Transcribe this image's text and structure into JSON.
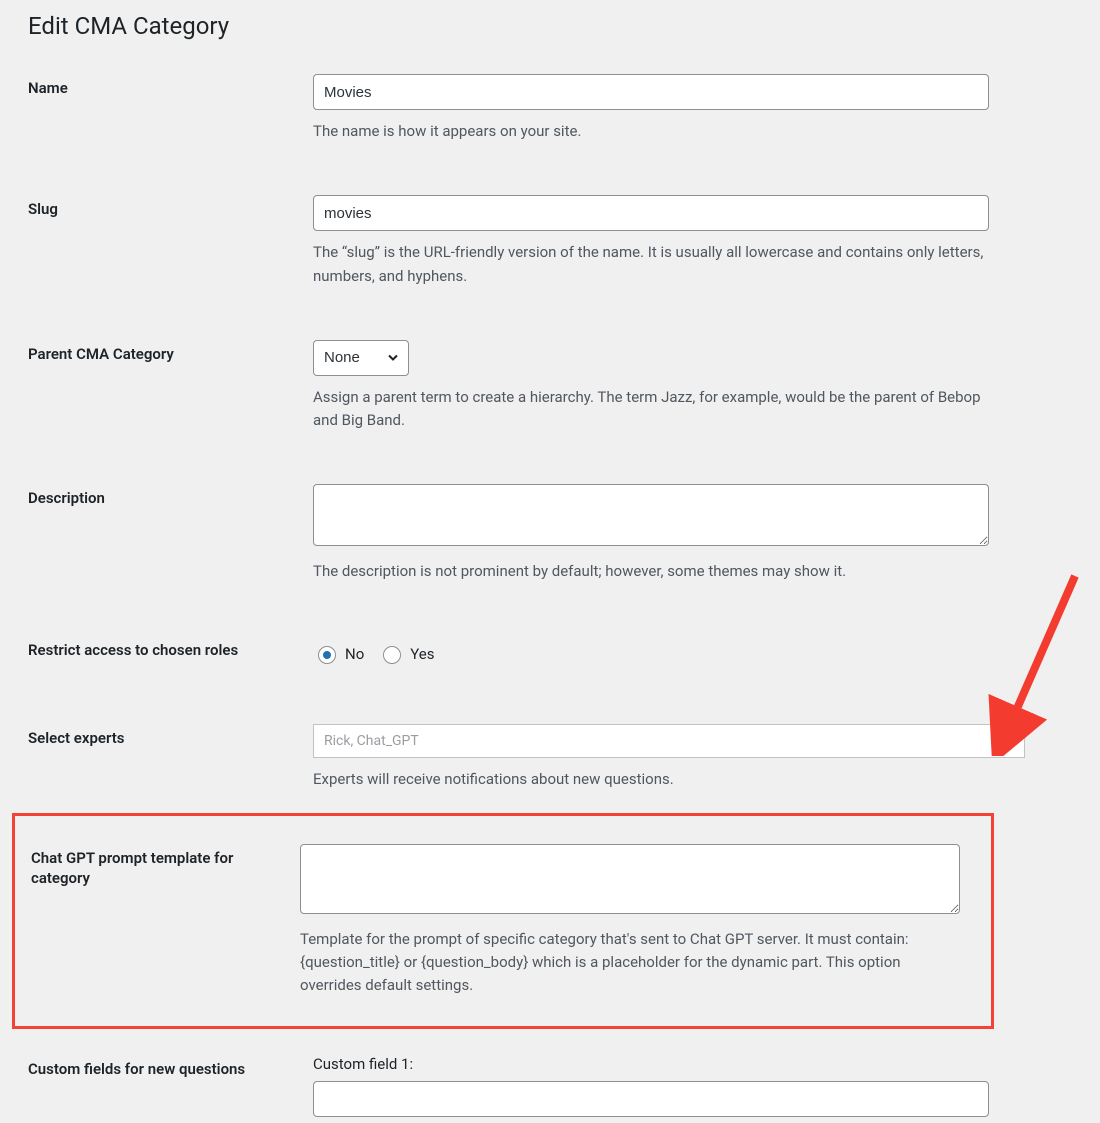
{
  "page": {
    "title": "Edit CMA Category"
  },
  "fields": {
    "name": {
      "label": "Name",
      "value": "Movies",
      "help": "The name is how it appears on your site."
    },
    "slug": {
      "label": "Slug",
      "value": "movies",
      "help": "The “slug” is the URL-friendly version of the name. It is usually all lowercase and contains only letters, numbers, and hyphens."
    },
    "parent": {
      "label": "Parent CMA Category",
      "selected": "None",
      "help": "Assign a parent term to create a hierarchy. The term Jazz, for example, would be the parent of Bebop and Big Band."
    },
    "description": {
      "label": "Description",
      "value": "",
      "help": "The description is not prominent by default; however, some themes may show it."
    },
    "restrict": {
      "label": "Restrict access to chosen roles",
      "no": "No",
      "yes": "Yes",
      "selected": "No"
    },
    "experts": {
      "label": "Select experts",
      "value": "Rick, Chat_GPT",
      "help": "Experts will receive notifications about new questions."
    },
    "gpt_template": {
      "label": "Chat GPT prompt template for category",
      "value": "",
      "help": "Template for the prompt of specific category that's sent to Chat GPT server. It must contain: {question_title} or {question_body} which is a placeholder for the dynamic part. This option overrides default settings."
    },
    "custom_fields": {
      "label": "Custom fields for new questions",
      "field1_label": "Custom field 1:"
    }
  }
}
